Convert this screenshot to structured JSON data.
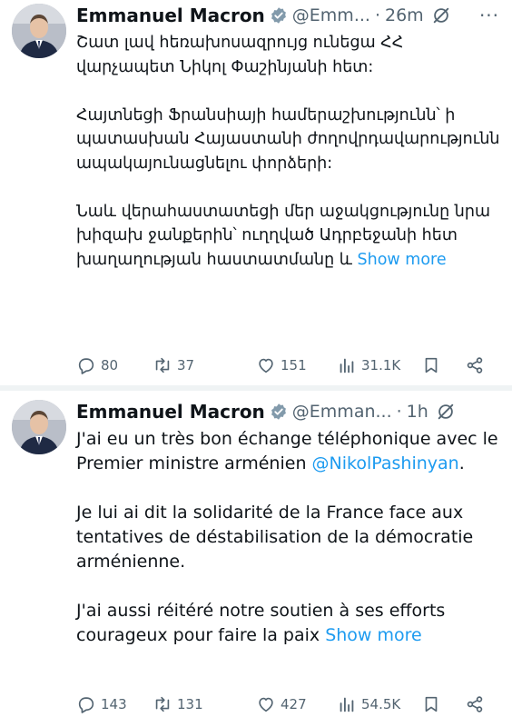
{
  "tweets": [
    {
      "author": "Emmanuel Macron",
      "handle": "@Emm...",
      "dot": "·",
      "time": "26m",
      "paragraphs": [
        "Շատ լավ հեռախոսազրույց ունեցա ՀՀ վարչապետ Նիկոլ Փաշինյանի հետ:",
        "Հայտնեցի Ֆրանսիայի համերաշխությունն՝ ի պատասխան Հայաստանի ժողովրդավարությունն ապակայունացնելու փորձերի:"
      ],
      "last_text": "Նաև վերահաստատեցի մեր աջակցությունը նրա խիզախ ջանքերին՝ ուղղված Ադրբեջանի հետ խաղաղության հաստատմանը և ",
      "show_more": "Show more",
      "stats": {
        "replies": "80",
        "retweets": "37",
        "likes": "151",
        "views": "31.1K"
      }
    },
    {
      "author": "Emmanuel Macron",
      "handle": "@Emman...",
      "dot": "·",
      "time": "1h",
      "p1_text": "J'ai eu un très bon échange téléphonique avec le Premier ministre arménien ",
      "mention": "@NikolPashinyan",
      "p1_end": ".",
      "p2": "Je lui ai dit la solidarité de la France face aux tentatives de déstabilisation de la démocratie arménienne.",
      "last_text": "J'ai aussi réitéré notre soutien à ses efforts courageux pour faire la paix ",
      "show_more": "Show more",
      "stats": {
        "replies": "143",
        "retweets": "131",
        "likes": "427",
        "views": "54.5K"
      }
    }
  ],
  "more_glyph": "···",
  "colors": {
    "accent": "#1d9bf0",
    "verified": "#829aab",
    "muted": "#536471",
    "text": "#0f1419"
  },
  "icons": [
    "verified-badge-icon",
    "grok-icon",
    "reply-icon",
    "retweet-icon",
    "like-icon",
    "views-icon",
    "bookmark-icon",
    "share-icon"
  ]
}
